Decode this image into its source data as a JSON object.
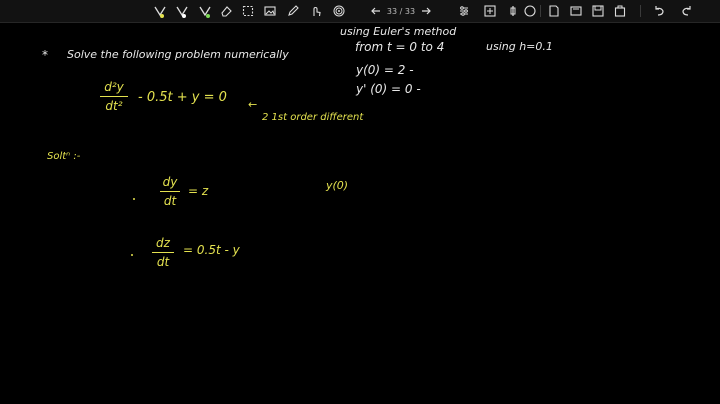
{
  "toolbar": {
    "page_indicator": "33 / 33",
    "icons": [
      "pen-1-icon",
      "pen-2-icon",
      "highlighter-icon",
      "eraser-icon",
      "lasso-icon",
      "image-icon",
      "pencil-icon",
      "touch-icon",
      "fingerprint-icon",
      "prev-page-icon",
      "next-page-icon",
      "settings-icon",
      "sliders-icon",
      "shapes-icon",
      "toggle-icon",
      "new-page-icon",
      "view-icon",
      "save-icon",
      "export-icon",
      "undo-icon",
      "redo-icon"
    ]
  },
  "notes": {
    "line1_problem": "Solve the following problem numerically",
    "line1_using": "using Euler's method",
    "line1_from": "from  t = 0 to 4",
    "line1_h": "using h=0.1",
    "ic_y": "y(0) = 2  -",
    "ic_yp": "y' (0) = 0  -",
    "eq_num": "d²y",
    "eq_den": "dt²",
    "eq_rest": "- 0.5t + y = 0",
    "eq_note": "2  1st  order  different",
    "solution_label": "Soltⁿ :-",
    "eq2_num": "dy",
    "eq2_den": "dt",
    "eq2_rhs": "= z",
    "eq2_side": "y(0)",
    "eq3_num": "dz",
    "eq3_den": "dt",
    "eq3_rhs": "=  0.5t  - y"
  }
}
